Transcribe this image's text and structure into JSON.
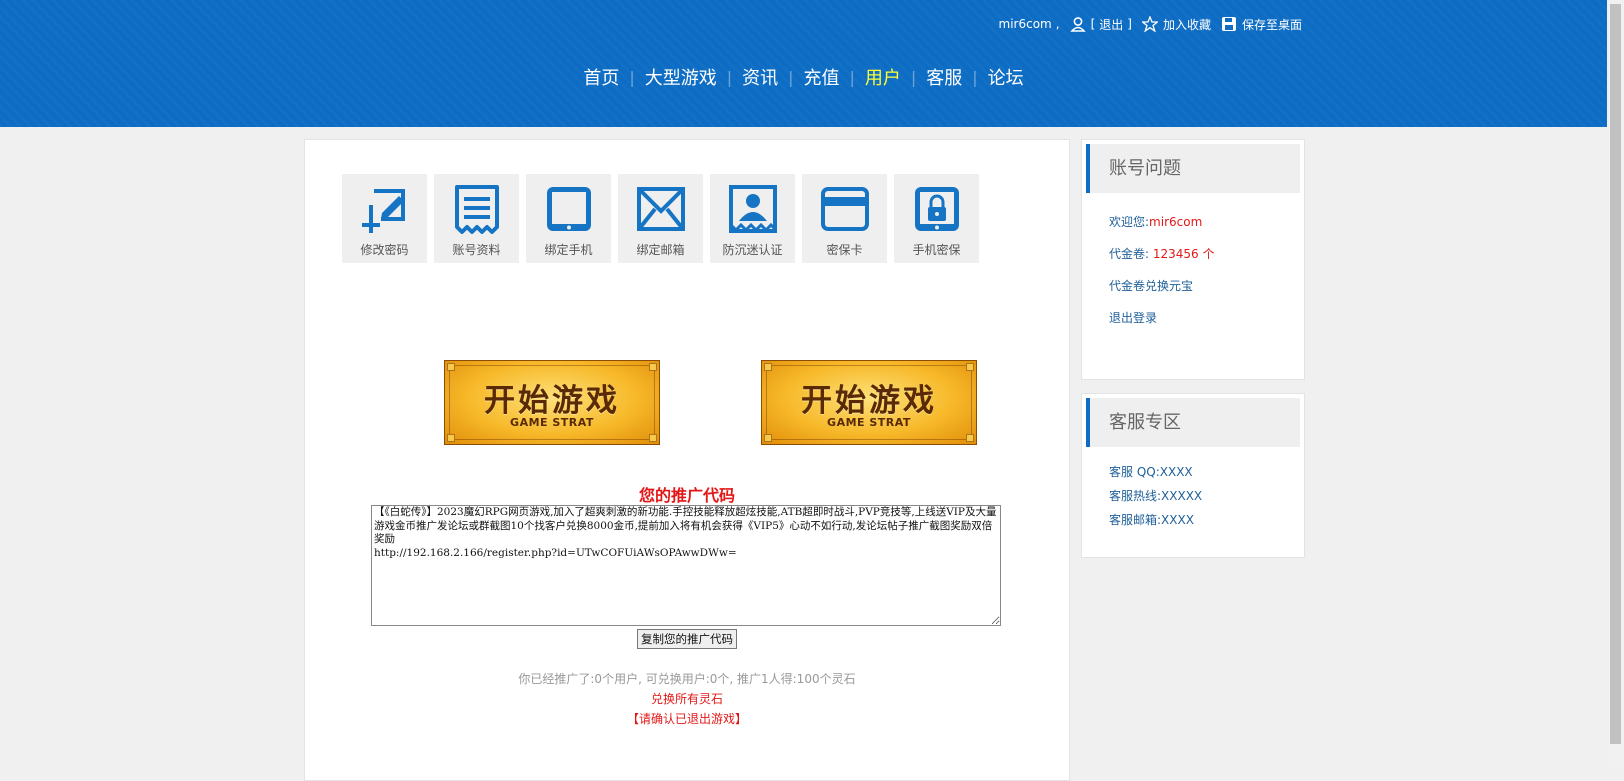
{
  "topbar": {
    "username": "mir6com",
    "comma": " ,",
    "logout_open": "[",
    "logout": "退出",
    "logout_close": "]",
    "favorite": "加入收藏",
    "save_desktop": "保存至桌面"
  },
  "nav": [
    {
      "label": "首页"
    },
    {
      "label": "大型游戏"
    },
    {
      "label": "资讯"
    },
    {
      "label": "充值"
    },
    {
      "label": "用户",
      "active": true
    },
    {
      "label": "客服"
    },
    {
      "label": "论坛"
    }
  ],
  "nav_separator": "|",
  "tiles": [
    {
      "label": "修改密码",
      "icon": "edit-password-icon"
    },
    {
      "label": "账号资料",
      "icon": "account-info-icon"
    },
    {
      "label": "绑定手机",
      "icon": "tablet-icon"
    },
    {
      "label": "绑定邮箱",
      "icon": "envelope-icon"
    },
    {
      "label": "防沉迷认证",
      "icon": "id-card-icon"
    },
    {
      "label": "密保卡",
      "icon": "security-card-icon"
    },
    {
      "label": "手机密保",
      "icon": "phone-lock-icon"
    }
  ],
  "game_buttons": [
    {
      "title": "开始游戏",
      "subtitle": "GAME STRAT"
    },
    {
      "title": "开始游戏",
      "subtitle": "GAME STRAT"
    }
  ],
  "promo": {
    "title": "您的推广代码",
    "text": "【《白蛇传》】2023魔幻RPG网页游戏,加入了超爽刺激的新功能.手控技能释放超炫技能,ATB超即时战斗,PVP竞技等,上线送VIP及大量游戏金币推广发论坛或群截图10个找客户兑换8000金币,提前加入将有机会获得《VIP5》心动不如行动,发论坛帖子推广截图奖励双倍奖励",
    "url": "http://192.168.2.166/register.php?id=UTwCOFUiAWsOPAwwDWw=",
    "copy_button": "复制您的推广代码",
    "stats": "你已经推广了:0个用户, 可兑换用户:0个, 推广1人得:100个灵石",
    "exchange": "兑换所有灵石",
    "confirm": "【请确认已退出游戏】"
  },
  "account_panel": {
    "title": "账号问题",
    "welcome_label": "欢迎您:",
    "welcome_user": "mir6com",
    "voucher_label": "代金卷: ",
    "voucher_value": "123456 个",
    "exchange_link": "代金卷兑换元宝",
    "logout_link": "退出登录"
  },
  "service_panel": {
    "title": "客服专区",
    "qq": "客服 QQ:XXXX",
    "hotline": "客服热线:XXXXX",
    "email": "客服邮箱:XXXX"
  },
  "colors": {
    "header_blue": "#0d6cc3",
    "nav_active": "#ffff33",
    "alert_red": "#e21818",
    "link_blue": "#1f5f99"
  }
}
